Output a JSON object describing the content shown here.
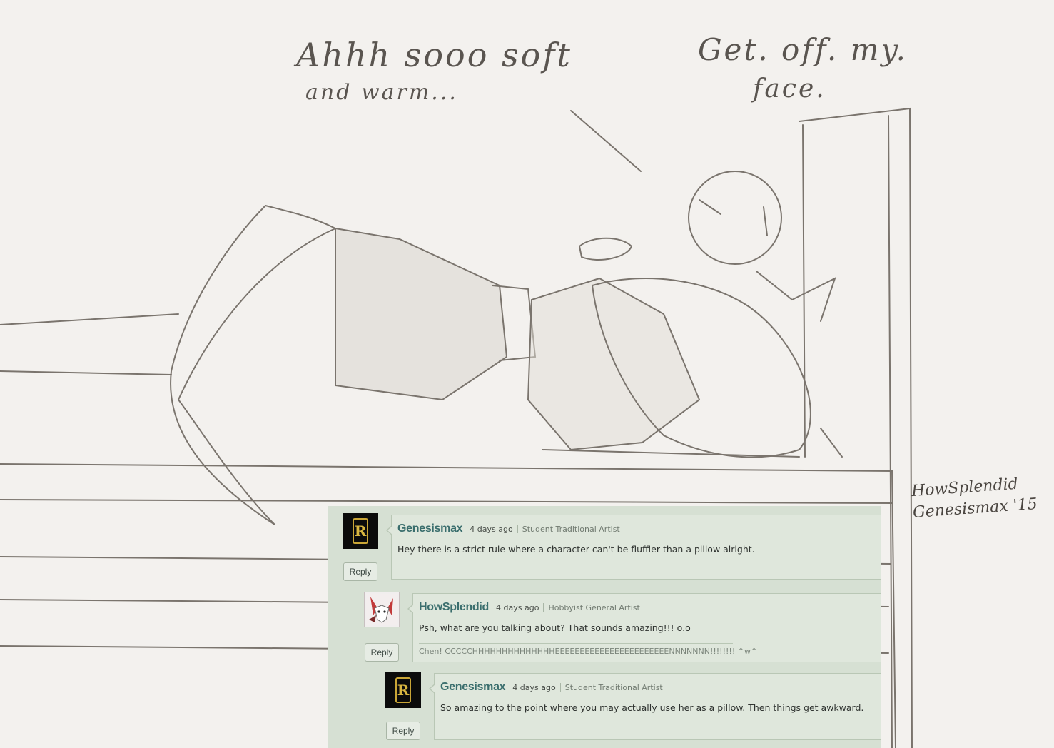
{
  "speech": {
    "line1": "Ahhh sooo soft",
    "line2": "and warm...",
    "reply1": "Get. off. my.",
    "reply2": "face."
  },
  "signature": {
    "name": "HowSplendid",
    "date": "Genesismax '15"
  },
  "comments": [
    {
      "username": "Genesismax",
      "time": "4 days ago",
      "role": "Student Traditional Artist",
      "text": "Hey there is a strict rule where a character can't be fluffier than a pillow alright.",
      "reply_label": "Reply",
      "avatar": "r-logo-avatar"
    },
    {
      "username": "HowSplendid",
      "time": "4 days ago",
      "role": "Hobbyist General Artist",
      "text": "Psh, what are you talking about? That sounds amazing!!! o.o",
      "signature": "Chen! CCCCCHHHHHHHHHHHHHHEEEEEEEEEEEEEEEEEEEEEEENNNNNNN!!!!!!!! ^w^",
      "reply_label": "Reply",
      "avatar": "fox-avatar"
    },
    {
      "username": "Genesismax",
      "time": "4 days ago",
      "role": "Student Traditional Artist",
      "text": "So amazing to the point where you may actually use her as a pillow. Then things get awkward.",
      "reply_label": "Reply",
      "avatar": "r-logo-avatar"
    }
  ]
}
